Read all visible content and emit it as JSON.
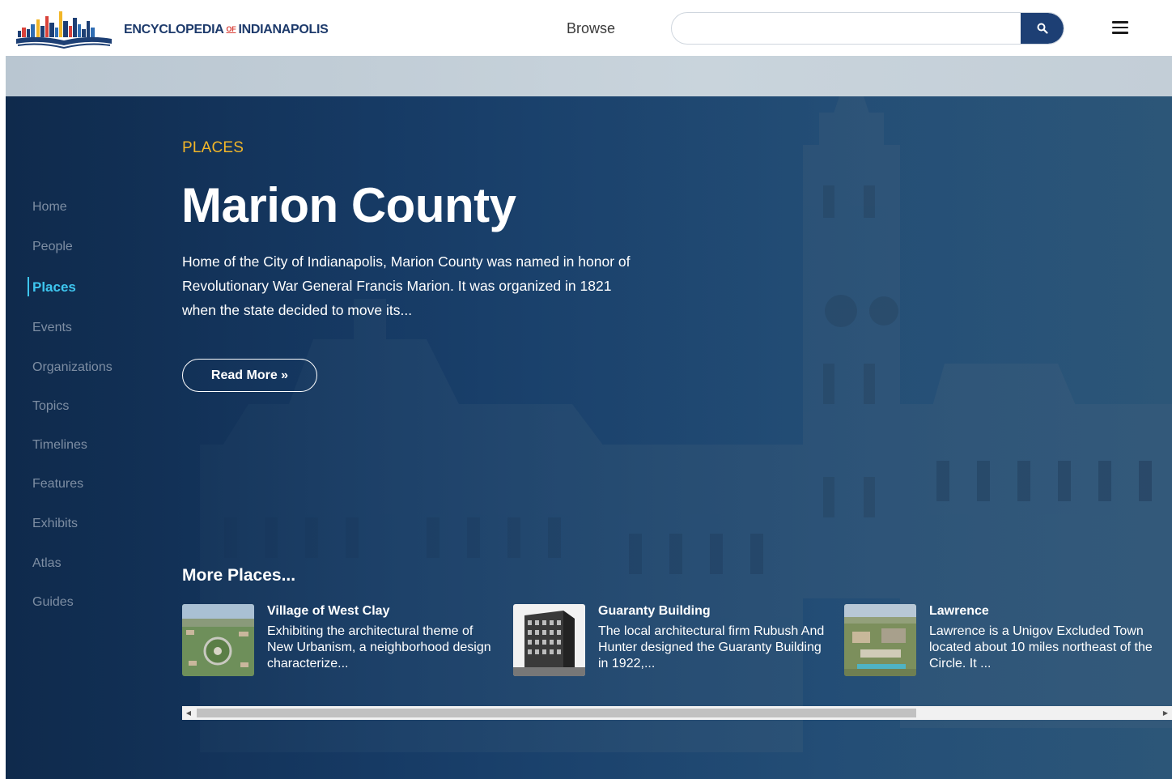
{
  "header": {
    "logo_text_left": "ENCYCLOPEDIA",
    "logo_text_of": "OF",
    "logo_text_right": "INDIANAPOLIS",
    "browse_label": "Browse",
    "search_placeholder": "",
    "search_value": "",
    "search_icon": "search-icon",
    "menu_icon": "hamburger-menu-icon"
  },
  "sidebar": {
    "items": [
      {
        "label": "Home",
        "active": false
      },
      {
        "label": "People",
        "active": false
      },
      {
        "label": "Places",
        "active": true
      },
      {
        "label": "Events",
        "active": false
      },
      {
        "label": "Organizations",
        "active": false
      },
      {
        "label": "Topics",
        "active": false
      },
      {
        "label": "Timelines",
        "active": false
      },
      {
        "label": "Features",
        "active": false
      },
      {
        "label": "Exhibits",
        "active": false
      },
      {
        "label": "Atlas",
        "active": false
      },
      {
        "label": "Guides",
        "active": false
      }
    ]
  },
  "main": {
    "category": "PLACES",
    "title": "Marion County",
    "summary": "Home of the City of Indianapolis, Marion County was named in honor of Revolutionary War General Francis Marion. It was organized in 1821 when the state decided to move its...",
    "read_more_label": "Read More »"
  },
  "more_places": {
    "heading": "More Places...",
    "cards": [
      {
        "title": "Village of West Clay",
        "description": "Exhibiting the architectural theme of New Urbanism, a neighborhood design characterize...",
        "thumb": "aerial-neighborhood-photo"
      },
      {
        "title": "Guaranty Building",
        "description": "The local architectural firm Rubush And Hunter designed the Guaranty Building in 1922,...",
        "thumb": "historic-building-photo"
      },
      {
        "title": "Lawrence",
        "description": "Lawrence is a Unigov Excluded Town located about 10 miles northeast of the Circle. It ...",
        "thumb": "aerial-town-photo"
      }
    ]
  },
  "colors": {
    "brand_navy": "#1d3f74",
    "accent_yellow": "#f2b628",
    "active_nav": "#3ec6ef",
    "nav_inactive": "#7e8ea3"
  }
}
